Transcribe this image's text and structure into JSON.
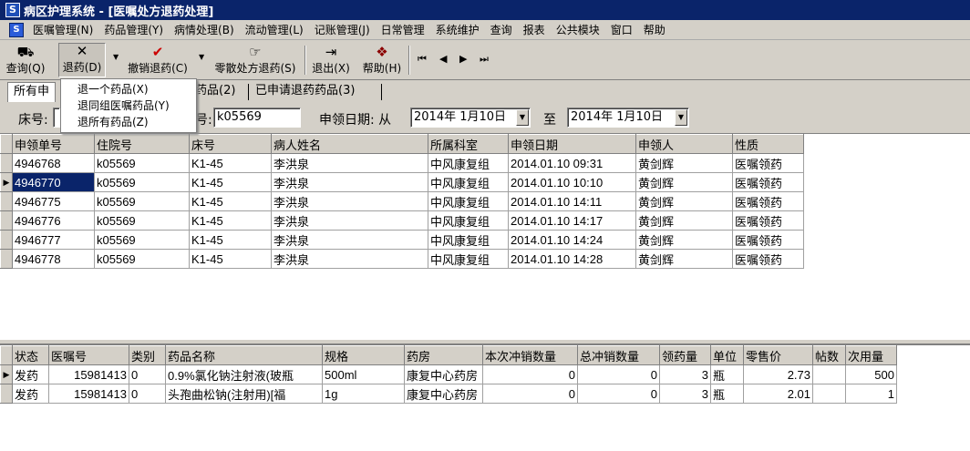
{
  "window": {
    "title": "病区护理系统 - [医嘱处方退药处理]",
    "icon_text": "S"
  },
  "menubar": {
    "icon_text": "S",
    "items": [
      "医嘱管理(N)",
      "药品管理(Y)",
      "病情处理(B)",
      "流动管理(L)",
      "记账管理(J)",
      "日常管理",
      "系统维护",
      "查询",
      "报表",
      "公共模块",
      "窗口",
      "帮助"
    ]
  },
  "toolbar": {
    "query": {
      "label": "查询(Q)",
      "icon": "binoculars-icon",
      "glyph": "⛟"
    },
    "return": {
      "label": "退药(D)",
      "icon": "x-icon",
      "glyph": "✕"
    },
    "cancel_return": {
      "label": "撤销退药(C)",
      "icon": "check-icon",
      "glyph": "✔"
    },
    "scatter_return": {
      "label": "零散处方退药(S)",
      "icon": "hand-pointer-icon",
      "glyph": "☞"
    },
    "exit": {
      "label": "退出(X)",
      "icon": "exit-door-icon",
      "glyph": "⇥"
    },
    "help": {
      "label": "帮助(H)",
      "icon": "help-book-icon",
      "glyph": "❖"
    },
    "nav": {
      "first": "⏮",
      "prev": "◀",
      "next": "▶",
      "last": "⏭"
    }
  },
  "popup": {
    "items": [
      "退一个药品(X)",
      "退同组医嘱药品(Y)",
      "退所有药品(Z)"
    ]
  },
  "tabs": {
    "active_label": "所有申",
    "second_label": "药品(2)",
    "third_label": "已申请退药药品(3)"
  },
  "filter": {
    "bed_label": "床号:",
    "inpatient_label": "号:",
    "inpatient_value": "k05569",
    "date_label": "申领日期: 从",
    "date_from": "2014年 1月10日",
    "date_to_label": "至",
    "date_to": "2014年 1月10日"
  },
  "upper_grid": {
    "columns": [
      "申领单号",
      "住院号",
      "床号",
      "病人姓名",
      "所属科室",
      "申领日期",
      "申领人",
      "性质"
    ],
    "rows": [
      [
        "4946768",
        "k05569",
        "K1-45",
        "李洪泉",
        "中风康复组",
        "2014.01.10 09:31",
        "黄剑辉",
        "医嘱领药"
      ],
      [
        "4946770",
        "k05569",
        "K1-45",
        "李洪泉",
        "中风康复组",
        "2014.01.10 10:10",
        "黄剑辉",
        "医嘱领药"
      ],
      [
        "4946775",
        "k05569",
        "K1-45",
        "李洪泉",
        "中风康复组",
        "2014.01.10 14:11",
        "黄剑辉",
        "医嘱领药"
      ],
      [
        "4946776",
        "k05569",
        "K1-45",
        "李洪泉",
        "中风康复组",
        "2014.01.10 14:17",
        "黄剑辉",
        "医嘱领药"
      ],
      [
        "4946777",
        "k05569",
        "K1-45",
        "李洪泉",
        "中风康复组",
        "2014.01.10 14:24",
        "黄剑辉",
        "医嘱领药"
      ],
      [
        "4946778",
        "k05569",
        "K1-45",
        "李洪泉",
        "中风康复组",
        "2014.01.10 14:28",
        "黄剑辉",
        "医嘱领药"
      ]
    ],
    "current_row": 1
  },
  "lower_grid": {
    "columns": [
      "状态",
      "医嘱号",
      "类别",
      "药品名称",
      "规格",
      "药房",
      "本次冲销数量",
      "总冲销数量",
      "领药量",
      "单位",
      "零售价",
      "帖数",
      "次用量"
    ],
    "rows": [
      [
        "发药",
        "15981413",
        "0",
        "0.9%氯化钠注射液(玻瓶",
        "500ml",
        "康复中心药房",
        "0",
        "0",
        "3",
        "瓶",
        "2.73",
        "",
        "500"
      ],
      [
        "发药",
        "15981413",
        "0",
        "头孢曲松钠(注射用)[福",
        "1g",
        "康复中心药房",
        "0",
        "0",
        "3",
        "瓶",
        "2.01",
        "",
        "1"
      ]
    ],
    "current_row": 0
  },
  "colors": {
    "title_bar": "#0a246a",
    "face": "#d4d0c8",
    "selection": "#0a246a",
    "cancel_check": "#cc0000"
  }
}
